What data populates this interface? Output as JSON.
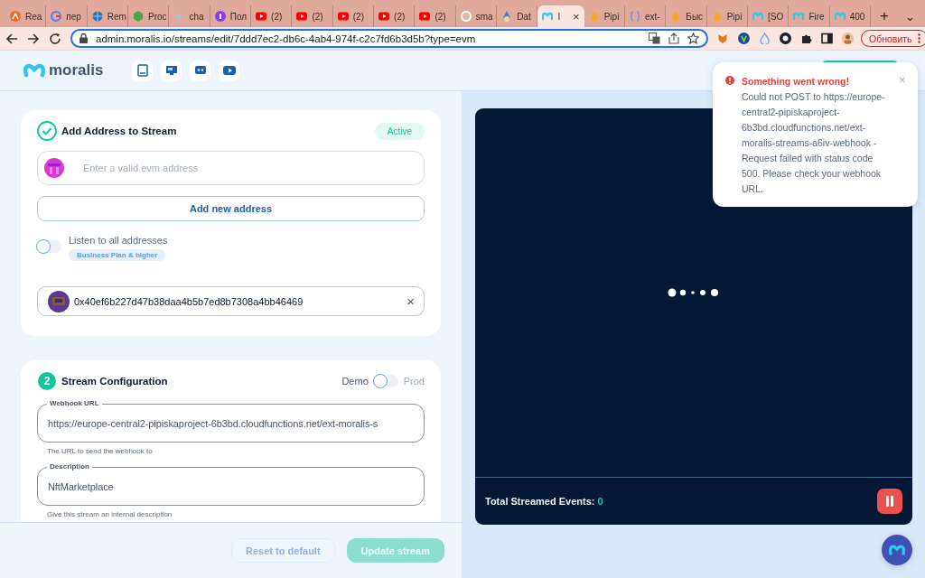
{
  "browser": {
    "tabs": [
      {
        "kind": "orange",
        "label": "Rea",
        "selected": false
      },
      {
        "kind": "google",
        "label": "пер",
        "selected": false
      },
      {
        "kind": "blue",
        "label": "Rem",
        "selected": false
      },
      {
        "kind": "green",
        "label": "Proc",
        "selected": false
      },
      {
        "kind": "spark",
        "label": "cha",
        "selected": false
      },
      {
        "kind": "purple",
        "label": "Пол",
        "selected": false
      },
      {
        "kind": "youtube",
        "label": "(2)",
        "selected": false
      },
      {
        "kind": "youtube",
        "label": "(2)",
        "selected": false
      },
      {
        "kind": "youtube",
        "label": "(2)",
        "selected": false
      },
      {
        "kind": "youtube",
        "label": "(2)",
        "selected": false
      },
      {
        "kind": "youtube",
        "label": "(2)",
        "selected": false
      },
      {
        "kind": "github",
        "label": "sma",
        "selected": false
      },
      {
        "kind": "wizard",
        "label": "Dat",
        "selected": false
      },
      {
        "kind": "moralis",
        "label": "I",
        "selected": true,
        "close": "×"
      },
      {
        "kind": "fire",
        "label": "Pipi",
        "selected": false
      },
      {
        "kind": "api",
        "label": "ext-",
        "selected": false
      },
      {
        "kind": "fire",
        "label": "Быс",
        "selected": false
      },
      {
        "kind": "fire",
        "label": "Pipi",
        "selected": false
      },
      {
        "kind": "moralis",
        "label": "[SO",
        "selected": false
      },
      {
        "kind": "moralis",
        "label": "Fire",
        "selected": false
      },
      {
        "kind": "moralis",
        "label": "400",
        "selected": false
      }
    ],
    "new_tab": "+",
    "tab_menu": "⌄",
    "url": "admin.moralis.io/streams/edit/7ddd7ec2-db6c-4ab4-974f-c2c7fd6b3d5b?type=evm",
    "update_button": "Обновить"
  },
  "header": {
    "logo": "moralis"
  },
  "address_card": {
    "title": "Add Address to Stream",
    "status": "Active",
    "address_input": {
      "placeholder": "Enter a valid evm address"
    },
    "add_button": "Add new address",
    "listen_all": {
      "label": "Listen to all addresses",
      "on": false,
      "badge": "Business Plan & higher"
    },
    "addresses": [
      {
        "value": "0x40ef6b227d47b38daa4b5b7ed8b7308a4bb46469",
        "remove": "×"
      }
    ]
  },
  "config_card": {
    "step": "2",
    "title": "Stream Configuration",
    "environment": {
      "left": "Demo",
      "right": "Prod",
      "prod": false
    },
    "fields": [
      {
        "label": "Webhook URL",
        "value": "https://europe-central2-pipiskaproject-6b3bd.cloudfunctions.net/ext-moralis-s",
        "hint": "The URL to send the webhook to"
      },
      {
        "label": "Description",
        "value": "NftMarketplace",
        "hint": "Give this stream an internal description"
      }
    ]
  },
  "footer": {
    "buttons": [
      {
        "kind": "secondary",
        "label": "Reset to default",
        "disabled": true
      },
      {
        "kind": "primary",
        "label": "Update stream",
        "disabled": true
      }
    ]
  },
  "events": {
    "label": "Total Streamed Events:",
    "count": "0"
  },
  "toast": {
    "title": "Something went wrong!",
    "message": "Could not POST to https://europe-central2-pipiskaproject-6b3bd.cloudfunctions.net/ext-moralis-streams-a6iv-webhook - Request failed with status code 500. Please check your webhook URL.",
    "close": "×"
  }
}
